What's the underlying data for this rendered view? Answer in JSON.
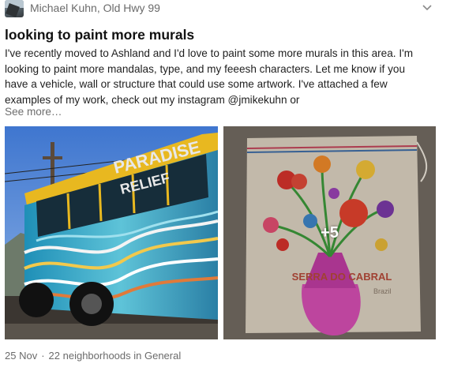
{
  "post": {
    "author": "Michael Kuhn, Old Hwy 99",
    "title": "looking to paint more murals",
    "body": "I've recently moved to Ashland and I'd love to paint some more murals in this area. I'm looking to paint more mandalas, type, and my feeesh characters. Let me know if you have a vehicle, wall or structure that could use some artwork. I've attached a few examples of my work, check out my instagram @jmikekuhn or",
    "see_more": "See more…",
    "photos": {
      "bus_sign_top": "PARADISE",
      "bus_sign_bottom": "RELIEF",
      "more_count": "+5",
      "bag_text_1": "SERRA DO CABRAL",
      "bag_text_2": "Brazil"
    },
    "footer": {
      "date": "25 Nov",
      "separator": "·",
      "audience": "22 neighborhoods in General"
    }
  },
  "colors": {
    "muted_text": "#6b6b6b",
    "title_text": "#111111",
    "bus_yellow": "#e8b820",
    "sky_blue": "#4a7fd0"
  },
  "icons": {
    "menu": "chevron-down-icon"
  }
}
